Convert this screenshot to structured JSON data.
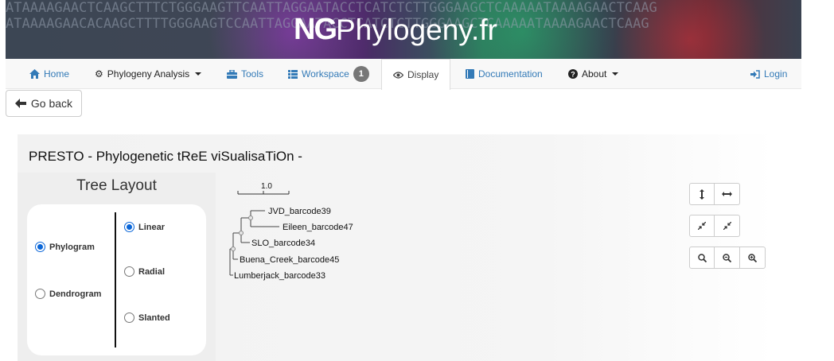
{
  "banner": {
    "seq_line1": "ATAAAAGAACTCAAGCTTTCTGGGAAGTTCAATTAGGAATACCTCATCTCTTGGGAAGCTCAAAAATAAAAGAACTCAAG",
    "seq_line2": "ATAAAAGAACACAAGCTTTTGGGAAGTCCAATTAGGAATACCTCATCTCTTGGGAAGCTCAAAAATAAAAGAACTCAAG",
    "logo_ng": "NG",
    "logo_text": "Phylogeny.fr"
  },
  "nav": {
    "home": "Home",
    "analysis": "Phylogeny Analysis",
    "tools": "Tools",
    "workspace": "Workspace",
    "workspace_count": "1",
    "display": "Display",
    "documentation": "Documentation",
    "about": "About",
    "login": "Login"
  },
  "goback": "Go back",
  "panel": {
    "title": "PRESTO - Phylogenetic tReE viSualisaTiOn -",
    "layout_title": "Tree Layout",
    "options": {
      "phylogram": "Phylogram",
      "dendrogram": "Dendrogram",
      "linear": "Linear",
      "radial": "Radial",
      "slanted": "Slanted"
    }
  },
  "tree": {
    "scale_label": "1.0",
    "leaves": [
      "JVD_barcode39",
      "Eileen_barcode47",
      "SLO_barcode34",
      "Buena_Creek_barcode45",
      "Lumberjack_barcode33"
    ]
  },
  "colors": {
    "link": "#337ab7",
    "radio_accent": "#0a66d8"
  }
}
